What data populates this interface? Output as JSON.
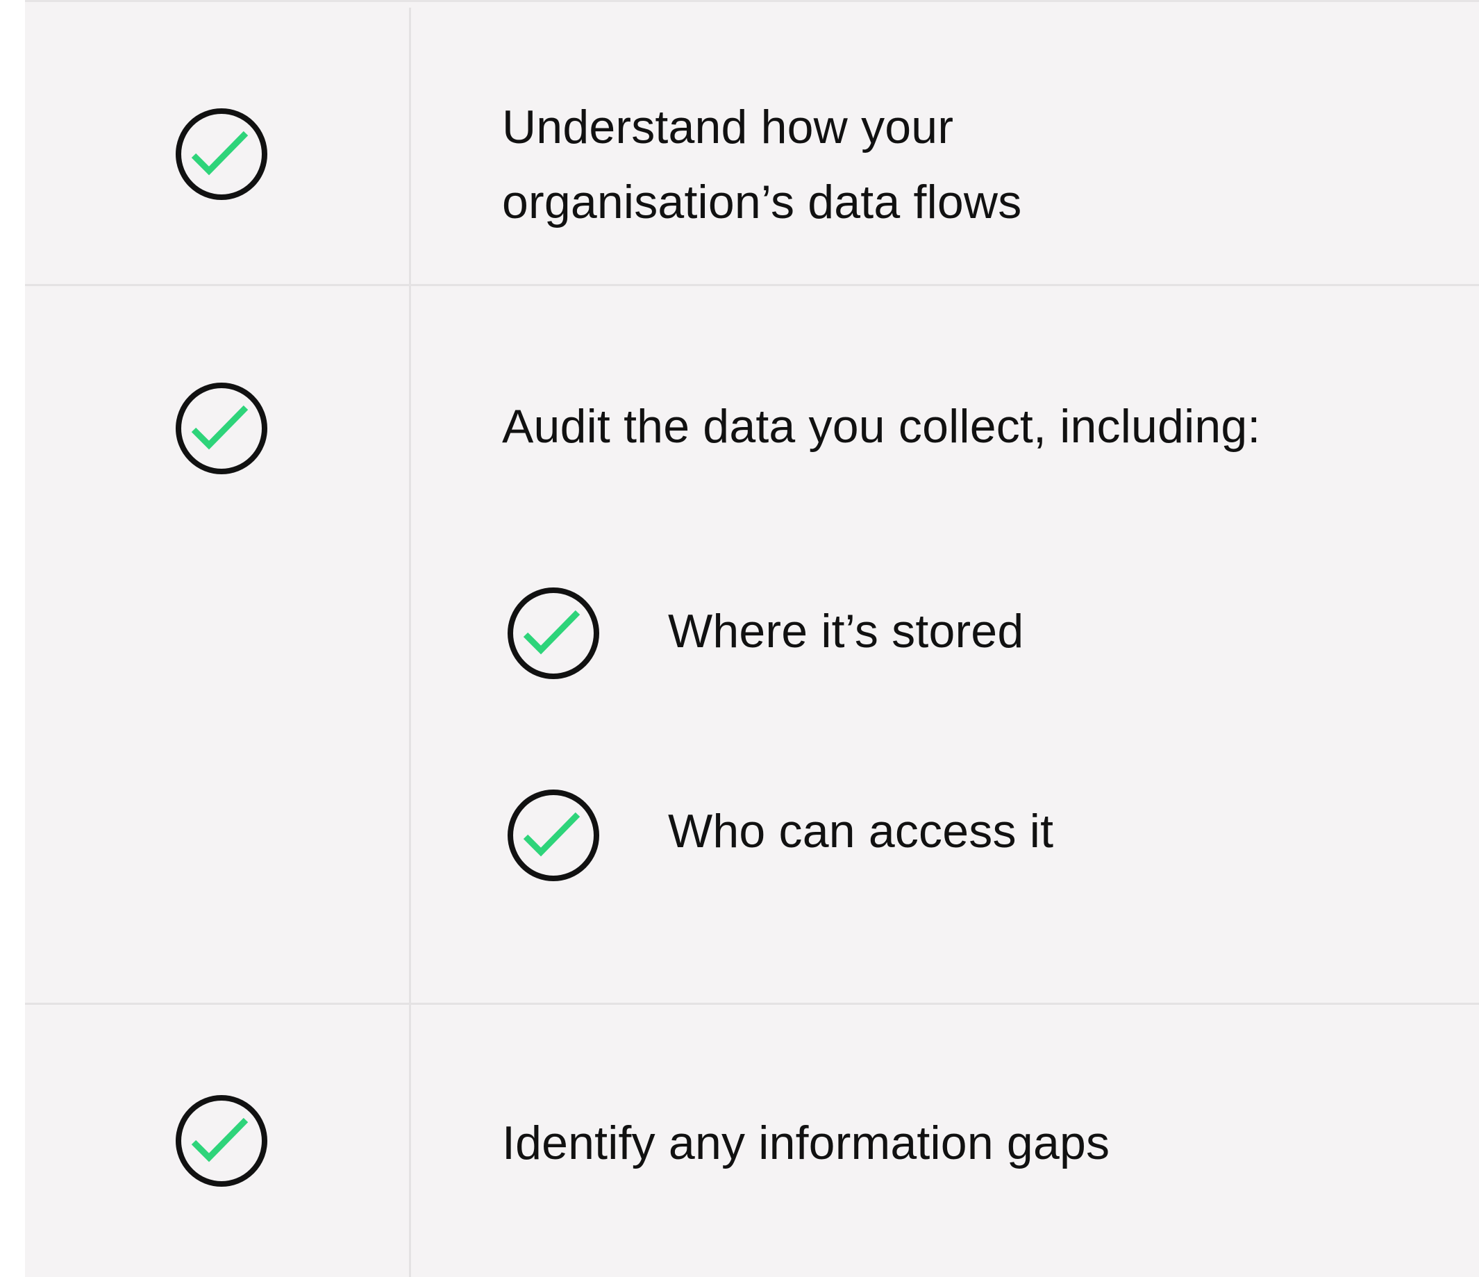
{
  "checklist": {
    "items": [
      {
        "lines": [
          "Understand how your",
          "organisation’s data flows"
        ]
      },
      {
        "label": "Audit the data you collect, including:",
        "sub_items": [
          {
            "label": "Where it’s stored"
          },
          {
            "label": "Who can access it"
          }
        ]
      },
      {
        "label": "Identify any information gaps"
      }
    ]
  },
  "colors": {
    "background": "#f5f3f4",
    "divider": "#e4e2e3",
    "check_circle": "#111111",
    "check_mark": "#2ed47a",
    "text": "#111111"
  },
  "icons": {
    "check": "check-circle-icon"
  }
}
